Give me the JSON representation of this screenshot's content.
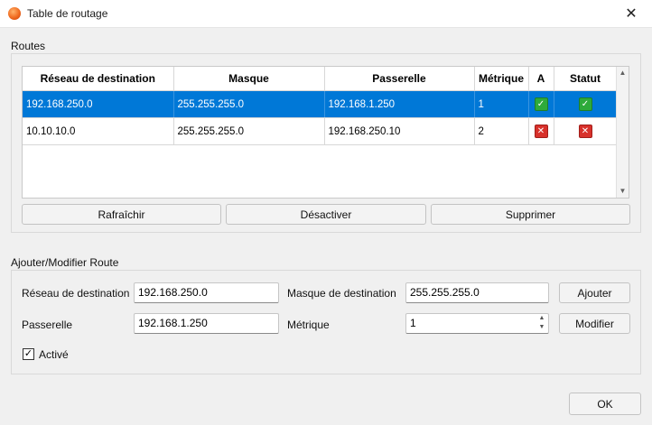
{
  "window": {
    "title": "Table de routage",
    "close_glyph": "✕"
  },
  "routes_group": {
    "label": "Routes"
  },
  "table": {
    "headers": [
      "Réseau de destination",
      "Masque",
      "Passerelle",
      "Métrique",
      "A",
      "Statut"
    ],
    "rows": [
      {
        "network": "192.168.250.0",
        "mask": "255.255.255.0",
        "gateway": "192.168.1.250",
        "metric": "1",
        "a": "✓",
        "status": "✓",
        "selected": true
      },
      {
        "network": "10.10.10.0",
        "mask": "255.255.255.0",
        "gateway": "192.168.250.10",
        "metric": "2",
        "a": "✕",
        "status": "✕",
        "selected": false
      }
    ]
  },
  "actions": {
    "refresh": "Rafraîchir",
    "disable": "Désactiver",
    "delete": "Supprimer"
  },
  "form": {
    "label": "Ajouter/Modifier Route",
    "dest_network_label": "Réseau de destination",
    "dest_network_value": "192.168.250.0",
    "dest_mask_label": "Masque de destination",
    "dest_mask_value": "255.255.255.0",
    "gateway_label": "Passerelle",
    "gateway_value": "192.168.1.250",
    "metric_label": "Métrique",
    "metric_value": "1",
    "add_button": "Ajouter",
    "modify_button": "Modifier",
    "enabled_label": "Activé",
    "enabled_check": "✓"
  },
  "footer": {
    "ok_button": "OK"
  },
  "colors": {
    "selection": "#0078d7",
    "ok_badge": "#2eaa3a",
    "error_badge": "#d8312b"
  }
}
